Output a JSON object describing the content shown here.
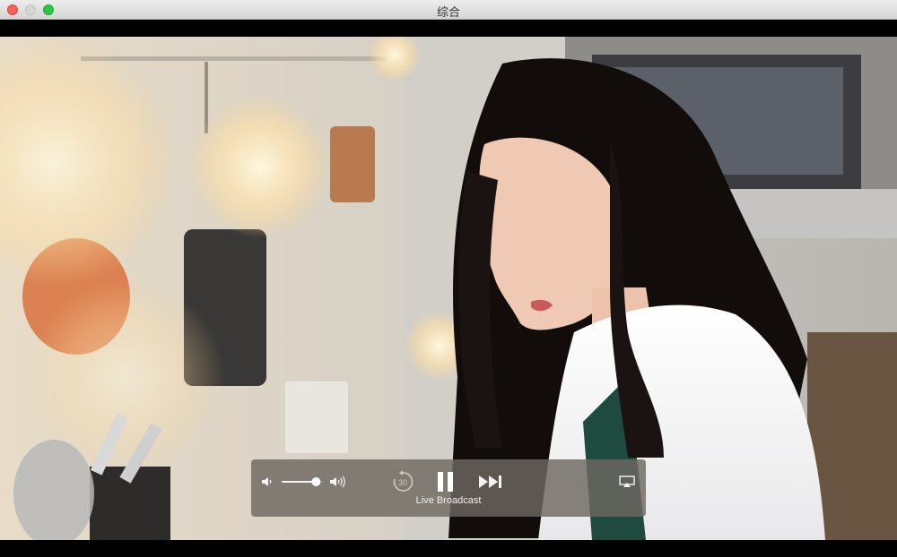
{
  "window": {
    "title": "综合"
  },
  "player": {
    "status_label": "Live Broadcast",
    "volume_level": 0.8,
    "skip_back_seconds": "30"
  },
  "icons": {
    "mute": "speaker-low-icon",
    "loud": "speaker-high-icon",
    "skip_back": "skip-back-30-icon",
    "pause": "pause-icon",
    "fast_forward": "fast-forward-icon",
    "airplay": "airplay-icon"
  }
}
